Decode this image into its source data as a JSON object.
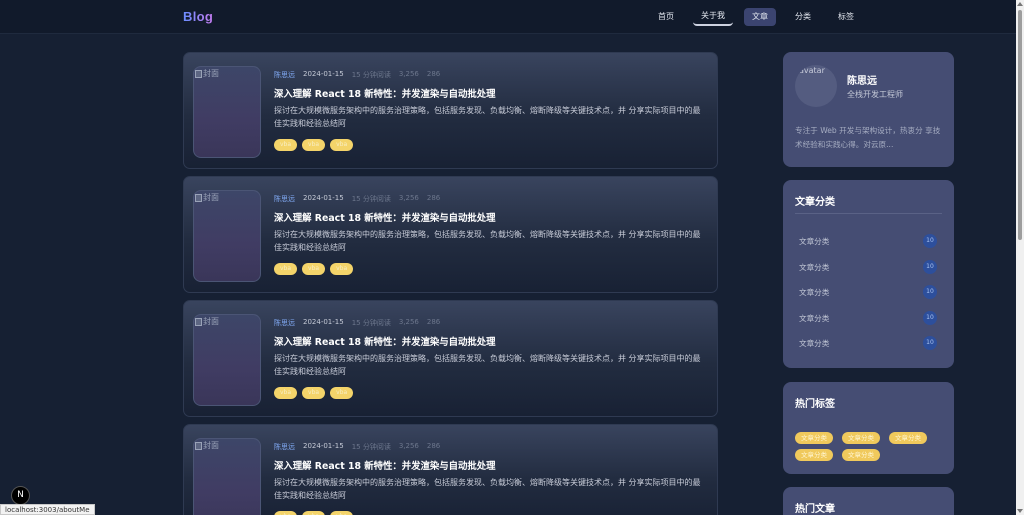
{
  "header": {
    "logo": "Blog",
    "nav": [
      {
        "label": "首页"
      },
      {
        "label": "关于我"
      },
      {
        "label": "文章"
      },
      {
        "label": "分类"
      },
      {
        "label": "标签"
      }
    ]
  },
  "articles": [
    {
      "image_alt": "封面",
      "author": "陈思远",
      "date": "2024-01-15",
      "read_time": "15 分钟阅读",
      "views": "3,256",
      "likes": "286",
      "title": "深入理解 React 18 新特性：并发渲染与自动批处理",
      "excerpt": "探讨在大规模微服务架构中的服务治理策略，包括服务发现、负载均衡、熔断降级等关键技术点，并 分享实际项目中的最佳实践和经验总结阿",
      "tags": [
        "vba",
        "vba",
        "vba"
      ]
    },
    {
      "image_alt": "封面",
      "author": "陈思远",
      "date": "2024-01-15",
      "read_time": "15 分钟阅读",
      "views": "3,256",
      "likes": "286",
      "title": "深入理解 React 18 新特性：并发渲染与自动批处理",
      "excerpt": "探讨在大规模微服务架构中的服务治理策略，包括服务发现、负载均衡、熔断降级等关键技术点，并 分享实际项目中的最佳实践和经验总结阿",
      "tags": [
        "vba",
        "vba",
        "vba"
      ]
    },
    {
      "image_alt": "封面",
      "author": "陈思远",
      "date": "2024-01-15",
      "read_time": "15 分钟阅读",
      "views": "3,256",
      "likes": "286",
      "title": "深入理解 React 18 新特性：并发渲染与自动批处理",
      "excerpt": "探讨在大规模微服务架构中的服务治理策略，包括服务发现、负载均衡、熔断降级等关键技术点，并 分享实际项目中的最佳实践和经验总结阿",
      "tags": [
        "vba",
        "vba",
        "vba"
      ]
    },
    {
      "image_alt": "封面",
      "author": "陈思远",
      "date": "2024-01-15",
      "read_time": "15 分钟阅读",
      "views": "3,256",
      "likes": "286",
      "title": "深入理解 React 18 新特性：并发渲染与自动批处理",
      "excerpt": "探讨在大规模微服务架构中的服务治理策略，包括服务发现、负载均衡、熔断降级等关键技术点，并 分享实际项目中的最佳实践和经验总结阿",
      "tags": [
        "vba",
        "vba",
        "vba"
      ]
    }
  ],
  "profile": {
    "avatar_alt": "avatar",
    "name": "陈思远",
    "role": "全栈开发工程师",
    "bio": "专注于 Web 开发与架构设计，热衷分 享技术经验和实践心得。对云原..."
  },
  "categories": {
    "title": "文章分类",
    "items": [
      {
        "label": "文章分类",
        "count": "10"
      },
      {
        "label": "文章分类",
        "count": "10"
      },
      {
        "label": "文章分类",
        "count": "10"
      },
      {
        "label": "文章分类",
        "count": "10"
      },
      {
        "label": "文章分类",
        "count": "10"
      }
    ]
  },
  "hot_tags": {
    "title": "热门标签",
    "items": [
      "文章分类",
      "文章分类",
      "文章分类",
      "文章分类",
      "文章分类"
    ]
  },
  "hot_posts": {
    "title": "热门文章"
  },
  "status_url": "localhost:3003/aboutMe",
  "next_badge": "N"
}
